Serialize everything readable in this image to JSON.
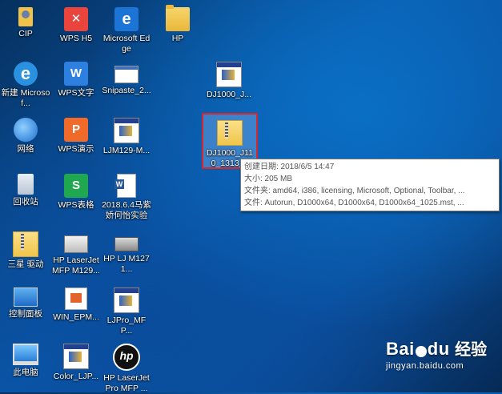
{
  "desktop": {
    "icons": [
      {
        "label": "CIP",
        "icon": "user-shortcut-icon"
      },
      {
        "label": "WPS H5",
        "icon": "wps-h5-icon"
      },
      {
        "label": "Microsoft Edge",
        "icon": "edge-icon"
      },
      {
        "label": "HP",
        "icon": "folder-icon"
      },
      {
        "label": "新建 Microsof...",
        "icon": "ie-icon"
      },
      {
        "label": "WPS文字",
        "icon": "wps-writer-icon"
      },
      {
        "label": "Snipaste_2...",
        "icon": "image-file-icon"
      },
      {
        "label": "DJ1000_J...",
        "icon": "installer-icon"
      },
      {
        "label": "网络",
        "icon": "network-icon"
      },
      {
        "label": "WPS演示",
        "icon": "wps-presentation-icon"
      },
      {
        "label": "LJM129-M...",
        "icon": "installer-icon"
      },
      {
        "label": "DJ1000_J110_1313_1",
        "icon": "zip-folder-icon"
      },
      {
        "label": "回收站",
        "icon": "recycle-bin-icon"
      },
      {
        "label": "WPS表格",
        "icon": "wps-spreadsheet-icon"
      },
      {
        "label": "2018.6.4马紫娇何怡实验",
        "icon": "word-document-icon"
      },
      {
        "label": "三星 驱动",
        "icon": "zip-folder-icon"
      },
      {
        "label": "HP LaserJet MFP M129...",
        "icon": "printer-icon"
      },
      {
        "label": "HP LJ M1271...",
        "icon": "scanner-icon"
      },
      {
        "label": "控制面板",
        "icon": "control-panel-icon"
      },
      {
        "label": "WIN_EPM...",
        "icon": "presentation-icon"
      },
      {
        "label": "LJPro_MFP...",
        "icon": "installer-icon"
      },
      {
        "label": "此电脑",
        "icon": "computer-icon"
      },
      {
        "label": "Color_LJP...",
        "icon": "installer-icon"
      },
      {
        "label": "HP LaserJet Pro MFP ...",
        "icon": "hp-logo-icon"
      }
    ]
  },
  "tooltip": {
    "created": "创建日期: 2018/6/5 14:47",
    "size": "大小: 205 MB",
    "folders": "文件夹: amd64, i386, licensing, Microsoft, Optional, Toolbar, ...",
    "files": "文件: Autorun, D1000x64, D1000x64, D1000x64_1025.mst, ..."
  },
  "watermark": {
    "logo": "Bai",
    "logo_suffix": "du",
    "sub": "经验",
    "url": "jingyan.baidu.com"
  }
}
